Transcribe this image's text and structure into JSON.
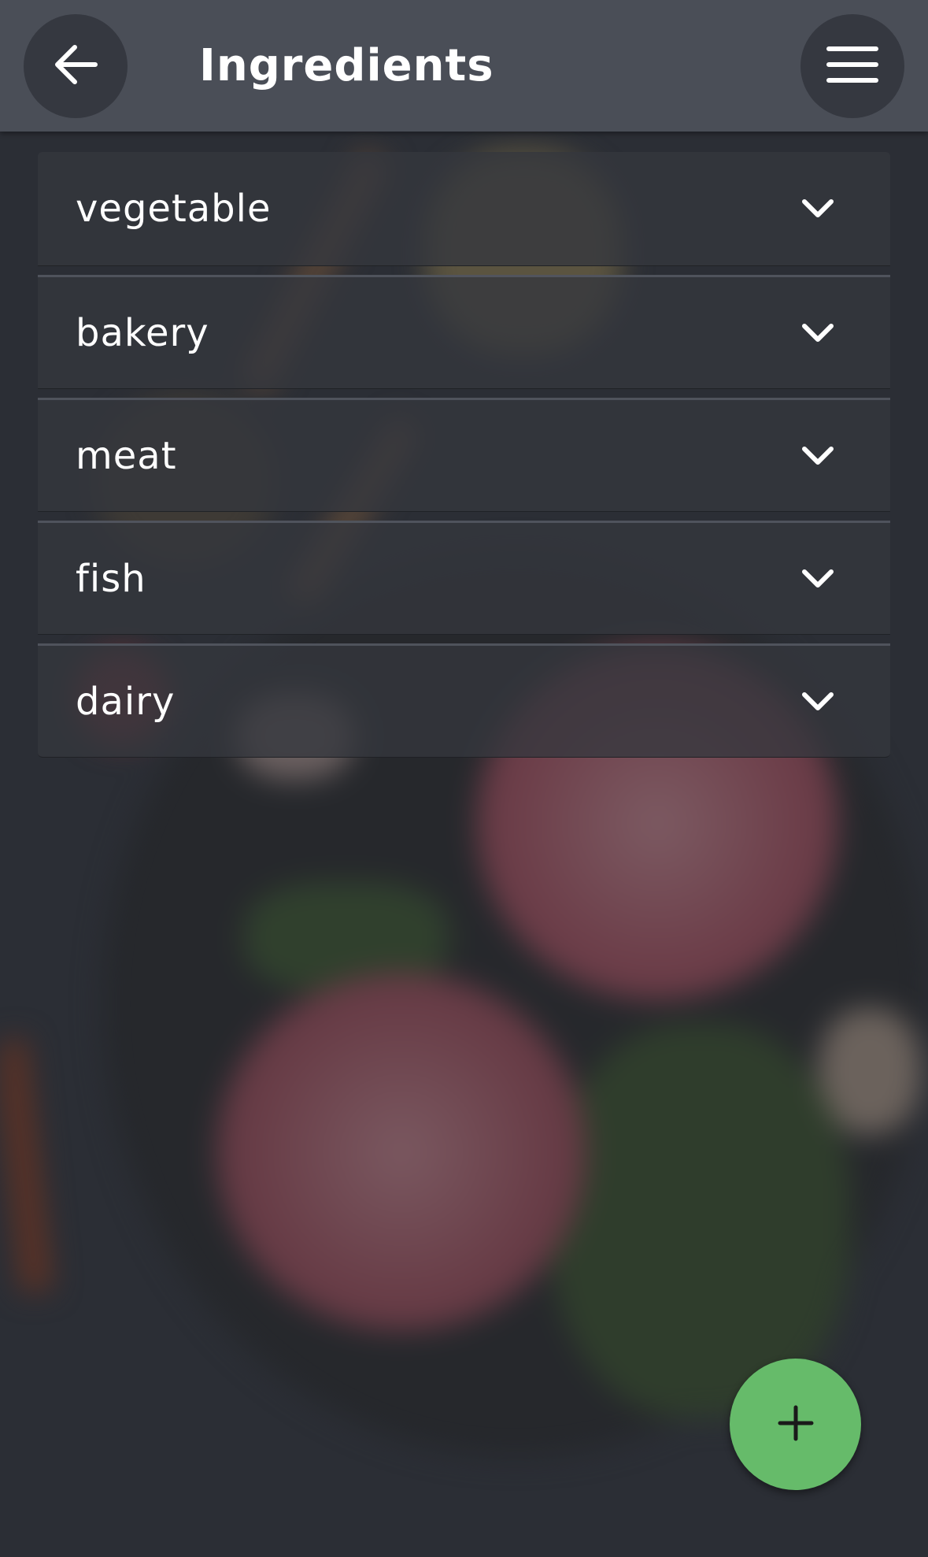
{
  "app_bar": {
    "title": "Ingredients",
    "back_icon": "arrow-left-icon",
    "menu_icon": "hamburger-menu-icon",
    "background_color": "#4a4e57"
  },
  "categories": [
    {
      "label": "vegetable",
      "icon": "chevron-down-icon"
    },
    {
      "label": "bakery",
      "icon": "chevron-down-icon"
    },
    {
      "label": "meat",
      "icon": "chevron-down-icon"
    },
    {
      "label": "fish",
      "icon": "chevron-down-icon"
    },
    {
      "label": "dairy",
      "icon": "chevron-down-icon"
    }
  ],
  "fab": {
    "icon": "plus-icon",
    "color": "#66bb6a"
  }
}
